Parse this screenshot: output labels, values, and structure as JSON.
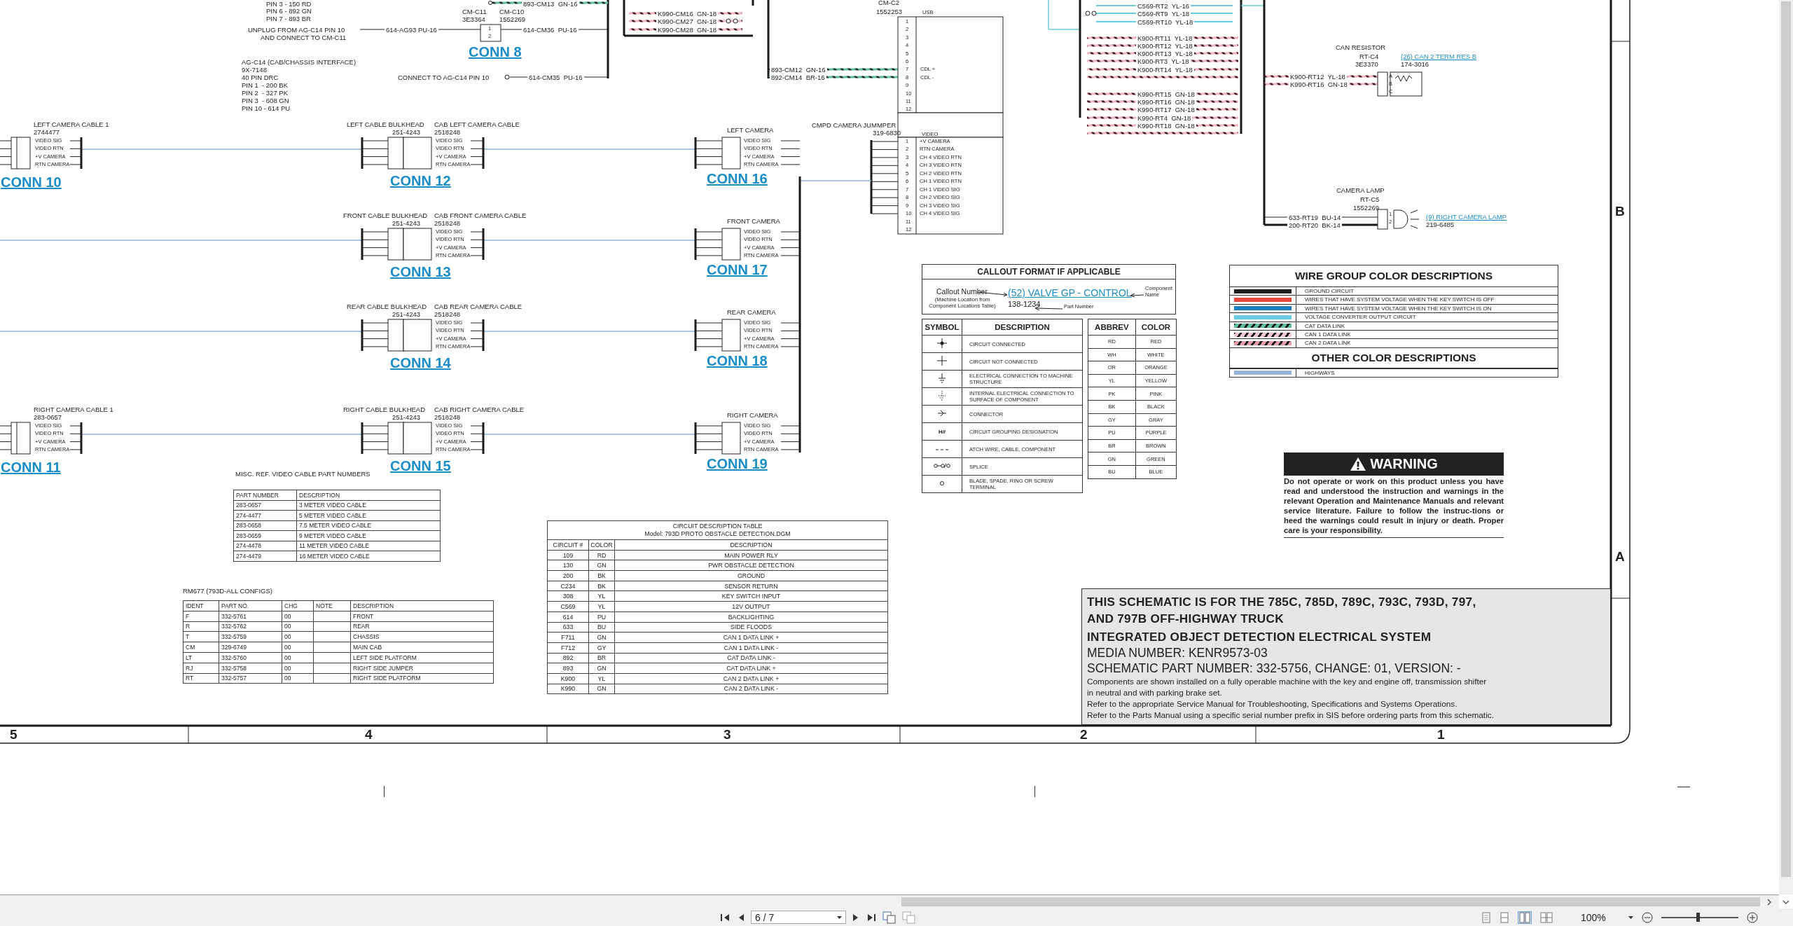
{
  "viewer": {
    "page_field": "6 / 7",
    "zoom": "100%",
    "zoom_slider": {
      "level": 0.48
    }
  },
  "sheet": {
    "column_numbers": [
      "5",
      "4",
      "3",
      "2",
      "1"
    ],
    "row_letters": [
      "B",
      "A"
    ]
  },
  "wire_labels": [
    "PIN 3 - 150 RD",
    "PIN 6 - 892 GN",
    "PIN 7 - 893 BR",
    "893-CM13  GN-16",
    "UNPLUG FROM AG-C14 PIN 10",
    "AND CONNECT TO CM-C11",
    "614-AG93 PU-16",
    "CM-C11",
    "3E3364",
    "CM-C10",
    "1552269",
    "614-CM36  PU-16",
    "AG-C14 (CAB/CHASSIS INTERFACE)",
    "9X-7148",
    "40 PIN DRC",
    "PIN 1  - 200 BK",
    "PIN 2  - 327 PK",
    "PIN 3  - 608 GN",
    "PIN 10 - 614 PU",
    "CONNECT TO AG-C14 PIN 10",
    "614-CM35  PU-16",
    "K990-CM16  GN-18",
    "K990-CM27  GN-18",
    "K990-CM28  GN-18",
    "893-CM12  GN-16",
    "892-CM14  BR-16",
    "C569-RT2  YL-16",
    "C569-RT9  YL-18",
    "C569-RT10  YL-18",
    "K900-RT11  YL-18",
    "K900-RT12  YL-18",
    "K900-RT13  YL-18",
    "K900-RT3  YL-18",
    "K900-RT14  YL-18",
    "K990-RT15  GN-18",
    "K990-RT16  GN-18",
    "K990-RT17  GN-18",
    "K990-RT4  GN-18",
    "K990-RT18  GN-18",
    "K900-RT12  YL-18",
    "K990-RT16  GN-18",
    "633-RT19  BU-14",
    "200-RT20  BK-14"
  ],
  "conn8": {
    "label": "CONN 8",
    "pins": [
      "1",
      "2"
    ]
  },
  "cable_rows": [
    {
      "cable": {
        "name": "LEFT CAMERA CABLE 1",
        "part": "2744477",
        "conn": "CONN 10",
        "pins": [
          "VIDEO SIG",
          "VIDEO RTN",
          "+V CAMERA",
          "RTN CAMERA"
        ]
      },
      "bulkhead": {
        "name": "LEFT CABLE BULKHEAD",
        "part": "251-4243",
        "cab_name": "CAB LEFT CAMERA CABLE",
        "cab_part": "2518248",
        "conn": "CONN 12",
        "pins": [
          "VIDEO SIG",
          "VIDEO RTN",
          "+V CAMERA",
          "RTN CAMERA"
        ]
      },
      "camera": {
        "name": "LEFT CAMERA",
        "conn": "CONN 16",
        "pins": [
          "VIDEO SIG",
          "VIDEO RTN",
          "+V CAMERA",
          "RTN CAMERA"
        ]
      }
    },
    {
      "bulkhead": {
        "name": "FRONT CABLE BULKHEAD",
        "part": "251-4243",
        "cab_name": "CAB FRONT CAMERA CABLE",
        "cab_part": "2518248",
        "conn": "CONN 13",
        "pins": [
          "VIDEO SIG",
          "VIDEO RTN",
          "+V CAMERA",
          "RTN CAMERA"
        ]
      },
      "camera": {
        "name": "FRONT CAMERA",
        "conn": "CONN 17",
        "pins": [
          "VIDEO SIG",
          "VIDEO RTN",
          "+V CAMERA",
          "RTN CAMERA"
        ]
      }
    },
    {
      "bulkhead": {
        "name": "REAR CABLE BULKHEAD",
        "part": "251-4243",
        "cab_name": "CAB REAR CAMERA CABLE",
        "cab_part": "2518248",
        "conn": "CONN 14",
        "pins": [
          "VIDEO SIG",
          "VIDEO RTN",
          "+V CAMERA",
          "RTN CAMERA"
        ]
      },
      "camera": {
        "name": "REAR CAMERA",
        "conn": "CONN 18",
        "pins": [
          "VIDEO SIG",
          "VIDEO RTN",
          "+V CAMERA",
          "RTN CAMERA"
        ]
      }
    },
    {
      "cable": {
        "name": "RIGHT CAMERA CABLE 1",
        "part": "283-0657",
        "conn": "CONN 11",
        "pins": [
          "VIDEO SIG",
          "VIDEO RTN",
          "+V CAMERA",
          "RTN CAMERA"
        ]
      },
      "bulkhead": {
        "name": "RIGHT CABLE BULKHEAD",
        "part": "251-4243",
        "cab_name": "CAB RIGHT CAMERA CABLE",
        "cab_part": "2518248",
        "conn": "CONN 15",
        "pins": [
          "VIDEO SIG",
          "VIDEO RTN",
          "+V CAMERA",
          "RTN CAMERA"
        ]
      },
      "camera": {
        "name": "RIGHT CAMERA",
        "conn": "CONN 19",
        "pins": [
          "VIDEO SIG",
          "VIDEO RTN",
          "+V CAMERA",
          "RTN CAMERA"
        ]
      }
    }
  ],
  "cm_c2": {
    "name": "CM-C2",
    "part": "1552253",
    "section": "USB",
    "pins": [
      {
        "number": "1"
      },
      {
        "number": "2"
      },
      {
        "number": "3"
      },
      {
        "number": "4"
      },
      {
        "number": "5"
      },
      {
        "number": "6"
      },
      {
        "number": "7",
        "label": "CDL +"
      },
      {
        "number": "8",
        "label": "CDL -"
      },
      {
        "number": "9"
      },
      {
        "number": "10"
      },
      {
        "number": "11"
      },
      {
        "number": "12"
      }
    ]
  },
  "jumper": {
    "name": "CMPD CAMERA JUMMPER",
    "part": "319-6830",
    "section": "VIDEO",
    "pins": [
      {
        "number": "1",
        "label": "+V CAMERA"
      },
      {
        "number": "2",
        "label": "RTN CAMERA"
      },
      {
        "number": "3",
        "label": "CH 4 VIDEO RTN"
      },
      {
        "number": "4",
        "label": "CH 3 VIDEO RTN"
      },
      {
        "number": "5",
        "label": "CH 2 VIDEO RTN"
      },
      {
        "number": "6",
        "label": "CH 1 VIDEO RTN"
      },
      {
        "number": "7",
        "label": "CH 1 VIDEO SIG"
      },
      {
        "number": "8",
        "label": "CH 2 VIDEO SIG"
      },
      {
        "number": "9",
        "label": "CH 3 VIDEO SIG"
      },
      {
        "number": "10",
        "label": "CH 4 VIDEO SIG"
      },
      {
        "number": "11"
      },
      {
        "number": "12"
      }
    ]
  },
  "can_resistor": {
    "name": "CAN RESISTOR",
    "id": "RT-C4",
    "part": "3E3370",
    "callout": "(26) CAN 2 TERM RES B",
    "callout_part": "174-3016",
    "pins": [
      "A",
      "B",
      "C"
    ]
  },
  "camera_lamp": {
    "name": "CAMERA LAMP",
    "id": "RT-C5",
    "part": "1552269",
    "callout": "(9) RIGHT CAMERA LAMP",
    "callout_part": "219-6485",
    "pins": [
      "1",
      "2"
    ]
  },
  "callout_format": {
    "title": "CALLOUT FORMAT IF APPLICABLE",
    "callout_number": "Callout Number",
    "callout_note": "(Machine Location from Component Locations Table)",
    "example": "(52) VALVE GP - CONTROL",
    "component_label": "Component Name",
    "part_example": "138-1234",
    "part_label": "Part Number"
  },
  "symbols": {
    "columns": [
      "SYMBOL",
      "DESCRIPTION"
    ],
    "rows": [
      {
        "kind": "connected",
        "description": "CIRCUIT CONNECTED"
      },
      {
        "kind": "not_connected",
        "description": "CIRCUIT NOT CONNECTED"
      },
      {
        "kind": "ground",
        "description": "ELECTRICAL CONNECTION TO MACHINE STRUCTURE"
      },
      {
        "kind": "internal_ground",
        "description": "INTERNAL ELECTRICAL CONNECTION TO SURFACE OF COMPONENT"
      },
      {
        "kind": "connector",
        "description": "CONNECTOR"
      },
      {
        "kind": "text",
        "symbol": "H#",
        "description": "CIRCUIT GROUPING DESIGNATION"
      },
      {
        "kind": "dashed",
        "description": "ATCH WIRE, CABLE, COMPONENT"
      },
      {
        "kind": "splice",
        "description": "SPLICE"
      },
      {
        "kind": "terminal",
        "description": "BLADE, SPADE, RING OR SCREW TERMINAL"
      }
    ]
  },
  "colors": {
    "columns": [
      "ABBREV",
      "COLOR"
    ],
    "rows": [
      [
        "RD",
        "RED"
      ],
      [
        "WH",
        "WHITE"
      ],
      [
        "OR",
        "ORANGE"
      ],
      [
        "YL",
        "YELLOW"
      ],
      [
        "PK",
        "PINK"
      ],
      [
        "BK",
        "BLACK"
      ],
      [
        "GY",
        "GRAY"
      ],
      [
        "PU",
        "PURPLE"
      ],
      [
        "BR",
        "BROWN"
      ],
      [
        "GN",
        "GREEN"
      ],
      [
        "BU",
        "BLUE"
      ]
    ]
  },
  "wire_groups": {
    "title": "WIRE GROUP COLOR DESCRIPTIONS",
    "rows": [
      {
        "kind": "solid",
        "color": "#1c1c1c",
        "description": "GROUND CIRCUIT"
      },
      {
        "kind": "solid",
        "color": "#e8473c",
        "description": "WIRES THAT HAVE SYSTEM VOLTAGE WHEN THE KEY SWITCH IS OFF"
      },
      {
        "kind": "solid",
        "color": "#1a80c4",
        "description": "WIRES THAT HAVE SYSTEM VOLTAGE WHEN THE KEY SWITCH IS ON"
      },
      {
        "kind": "solid",
        "color": "#6ccbe4",
        "description": "VOLTAGE CONVERTER OUTPUT CIRCUIT"
      },
      {
        "kind": "striped",
        "color": "#5fbf9c",
        "description": "CAT DATA LINK"
      },
      {
        "kind": "striped",
        "color": "#f6c6d0",
        "description": "CAN 1 DATA LINK"
      },
      {
        "kind": "striped",
        "color": "#e79aa9",
        "description": "CAN 2 DATA LINK"
      }
    ],
    "other_title": "OTHER COLOR DESCRIPTIONS",
    "other_rows": [
      {
        "kind": "solid",
        "color": "#93b3da",
        "description": "HIGHWAYS"
      }
    ]
  },
  "warning": {
    "title": "WARNING",
    "text": "Do not operate or work on this product unless you have read and understood the instruction and warnings in the relevant Operation and Maintenance Manuals and relevant service literature. Failure to follow the instruc-tions or heed the warnings could result in injury or death. Proper care is your responsibility."
  },
  "title_block": [
    {
      "kind": "heading",
      "text": "THIS SCHEMATIC IS FOR THE 785C, 785D, 789C, 793C, 793D, 797,"
    },
    {
      "kind": "heading",
      "text": "AND 797B OFF-HIGHWAY TRUCK"
    },
    {
      "kind": "heading",
      "text": "INTEGRATED OBJECT DETECTION ELECTRICAL SYSTEM"
    },
    {
      "kind": "medium",
      "text": "MEDIA NUMBER: KENR9573-03"
    },
    {
      "kind": "medium",
      "text": "SCHEMATIC PART NUMBER: 332-5756, CHANGE: 01, VERSION: -"
    },
    {
      "kind": "small",
      "text": "Components are shown installed on a fully operable machine with the key and engine off, transmission shifter"
    },
    {
      "kind": "small",
      "text": "in neutral and with parking brake set."
    },
    {
      "kind": "small",
      "text": "Refer to the appropriate Service Manual for Troubleshooting, Specifications and Systems Operations."
    },
    {
      "kind": "small",
      "text": "Refer to the Parts Manual using a specific serial number prefix in SIS before ordering parts from this schematic."
    }
  ],
  "misc_table": {
    "title": "MISC. REF. VIDEO CABLE PART NUMBERS",
    "columns": [
      "PART NUMBER",
      "DESCRIPTION"
    ],
    "rows": [
      [
        "283-0657",
        "3 METER VIDEO CABLE"
      ],
      [
        "274-4477",
        "5 METER VIDEO CABLE"
      ],
      [
        "283-0658",
        "7.5 METER VIDEO CABLE"
      ],
      [
        "283-0659",
        "9 METER VIDEO CABLE"
      ],
      [
        "274-4478",
        "11 METER VIDEO CABLE"
      ],
      [
        "274-4479",
        "16 METER VIDEO CABLE"
      ]
    ]
  },
  "rm677": {
    "title": "RM677 (793D-ALL CONFIGS)",
    "columns": [
      "IDENT",
      "PART NO.",
      "CHG",
      "NOTE",
      "DESCRIPTION"
    ],
    "rows": [
      [
        "F",
        "332-5761",
        "00",
        "",
        "FRONT"
      ],
      [
        "R",
        "332-5762",
        "00",
        "",
        "REAR"
      ],
      [
        "T",
        "332-5759",
        "00",
        "",
        "CHASSIS"
      ],
      [
        "CM",
        "329-6749",
        "00",
        "",
        "MAIN CAB"
      ],
      [
        "LT",
        "332-5760",
        "00",
        "",
        "LEFT SIDE PLATFORM"
      ],
      [
        "RJ",
        "332-5758",
        "00",
        "",
        "RIGHT SIDE JUMPER"
      ],
      [
        "RT",
        "332-5757",
        "00",
        "",
        "RIGHT SIDE PLATFORM"
      ]
    ]
  },
  "circuit_table": {
    "title": "CIRCUIT DESCRIPTION TABLE",
    "subtitle": "Model: 793D PROTO OBSTACLE DETECTION.DGM",
    "columns": [
      "CIRCUIT #",
      "COLOR",
      "DESCRIPTION"
    ],
    "rows": [
      [
        "109",
        "RD",
        "MAIN POWER RLY"
      ],
      [
        "130",
        "GN",
        "PWR OBSTACLE DETECTION"
      ],
      [
        "200",
        "BK",
        "GROUND"
      ],
      [
        "C234",
        "BK",
        "SENSOR RETURN"
      ],
      [
        "308",
        "YL",
        "KEY SWITCH INPUT"
      ],
      [
        "C569",
        "YL",
        "12V OUTPUT"
      ],
      [
        "614",
        "PU",
        "BACKLIGHTING"
      ],
      [
        "633",
        "BU",
        "SIDE FLOODS"
      ],
      [
        "F711",
        "GN",
        "CAN 1 DATA LINK +"
      ],
      [
        "F712",
        "GY",
        "CAN 1 DATA LINK -"
      ],
      [
        "892",
        "BR",
        "CAT DATA LINK -"
      ],
      [
        "893",
        "GN",
        "CAT DATA LINK +"
      ],
      [
        "K900",
        "YL",
        "CAN 2 DATA LINK +"
      ],
      [
        "K990",
        "GN",
        "CAN 2 DATA LINK -"
      ]
    ]
  }
}
